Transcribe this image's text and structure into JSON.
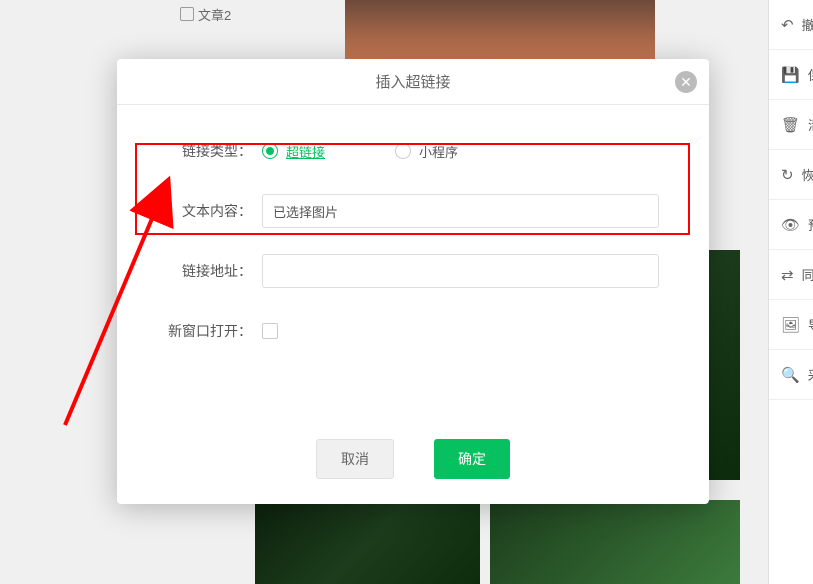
{
  "background": {
    "file_item": "文章2"
  },
  "toolbar": {
    "items": [
      {
        "icon": "↶",
        "label": "撤"
      },
      {
        "icon": "💾",
        "label": "保"
      },
      {
        "icon": "🗑",
        "label": "清"
      },
      {
        "icon": "↻",
        "label": "恢"
      },
      {
        "icon": "👁",
        "label": "预"
      },
      {
        "icon": "⇄",
        "label": "同"
      },
      {
        "icon": "🖼",
        "label": "导"
      },
      {
        "icon": "🔍",
        "label": "采"
      }
    ]
  },
  "modal": {
    "title": "插入超链接",
    "form": {
      "link_type_label": "链接类型：",
      "radio_hyperlink": "超链接",
      "radio_miniprogram": "小程序",
      "text_content_label": "文本内容：",
      "text_content_value": "已选择图片",
      "link_address_label": "链接地址：",
      "link_address_value": "",
      "new_window_label": "新窗口打开："
    },
    "cancel_label": "取消",
    "confirm_label": "确定"
  }
}
